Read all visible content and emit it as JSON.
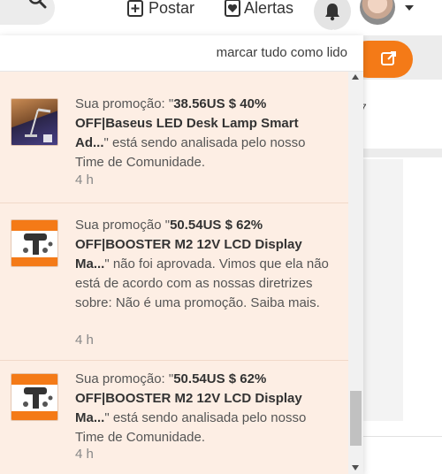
{
  "header": {
    "post_label": "Postar",
    "alerts_label": "Alertas"
  },
  "dropdown": {
    "mark_all_read": "marcar tudo como lido"
  },
  "notifications": [
    {
      "prefix": "Sua promoção: \"",
      "title": "38.56US $ 40% OFF|Baseus LED Desk Lamp Smart Ad...",
      "suffix": "\" está sendo analisada pelo nosso Time de Comunidade.",
      "time": "4 h",
      "thumb": "desk-lamp"
    },
    {
      "prefix": "Sua promoção \"",
      "title": "50.54US $ 62% OFF|BOOSTER M2 12V LCD Display Ma...",
      "suffix": "\" não foi aprovada. Vimos que ela não está de acordo com as nossas diretrizes sobre: Não é uma promoção. Saiba mais.",
      "time": "4 h",
      "thumb": "massage-gun"
    },
    {
      "prefix": "Sua promoção: \"",
      "title": "50.54US $ 62% OFF|BOOSTER M2 12V LCD Display Ma...",
      "suffix": "\" está sendo analisada pelo nosso Time de Comunidade.",
      "time": "4 h",
      "thumb": "massage-gun"
    }
  ],
  "scrollbar": {
    "position_fraction": 0.95
  },
  "colors": {
    "accent": "#f47a17",
    "unread_bg": "#fdeee4"
  }
}
